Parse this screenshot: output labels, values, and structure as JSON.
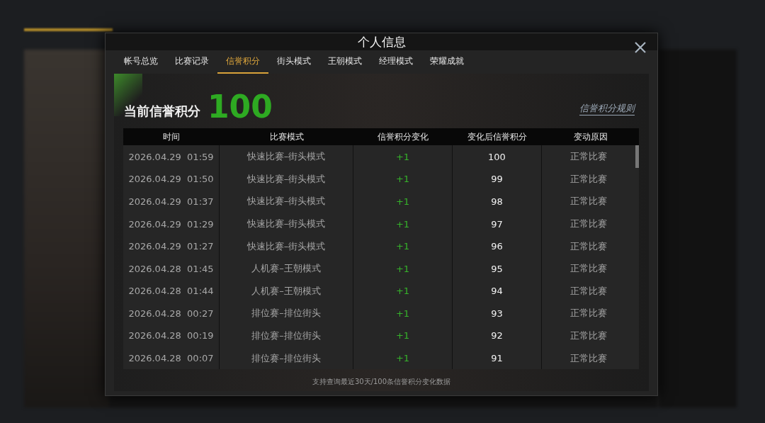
{
  "dialog": {
    "title": "个人信息"
  },
  "tabs": [
    {
      "label": "帐号总览",
      "selected": false
    },
    {
      "label": "比赛记录",
      "selected": false
    },
    {
      "label": "信誉积分",
      "selected": true
    },
    {
      "label": "街头模式",
      "selected": false
    },
    {
      "label": "王朝模式",
      "selected": false
    },
    {
      "label": "经理模式",
      "selected": false
    },
    {
      "label": "荣耀成就",
      "selected": false
    }
  ],
  "score": {
    "label": "当前信誉积分",
    "value": "100",
    "rules_link": "信誉积分规则"
  },
  "table": {
    "columns": [
      "时间",
      "比赛模式",
      "信誉积分变化",
      "变化后信誉积分",
      "变动原因"
    ],
    "rows": [
      [
        "2026.04.29  01:59",
        "快速比赛–街头模式",
        "+1",
        "100",
        "正常比赛"
      ],
      [
        "2026.04.29  01:50",
        "快速比赛–街头模式",
        "+1",
        "99",
        "正常比赛"
      ],
      [
        "2026.04.29  01:37",
        "快速比赛–街头模式",
        "+1",
        "98",
        "正常比赛"
      ],
      [
        "2026.04.29  01:29",
        "快速比赛–街头模式",
        "+1",
        "97",
        "正常比赛"
      ],
      [
        "2026.04.29  01:27",
        "快速比赛–街头模式",
        "+1",
        "96",
        "正常比赛"
      ],
      [
        "2026.04.28  01:45",
        "人机赛–王朝模式",
        "+1",
        "95",
        "正常比赛"
      ],
      [
        "2026.04.28  01:44",
        "人机赛–王朝模式",
        "+1",
        "94",
        "正常比赛"
      ],
      [
        "2026.04.28  00:27",
        "排位赛–排位街头",
        "+1",
        "93",
        "正常比赛"
      ],
      [
        "2026.04.28  00:19",
        "排位赛–排位街头",
        "+1",
        "92",
        "正常比赛"
      ],
      [
        "2026.04.28  00:07",
        "排位赛–排位街头",
        "+1",
        "91",
        "正常比赛"
      ]
    ]
  },
  "footer_note": "支持查询最近30天/100条信誉积分变化数据"
}
